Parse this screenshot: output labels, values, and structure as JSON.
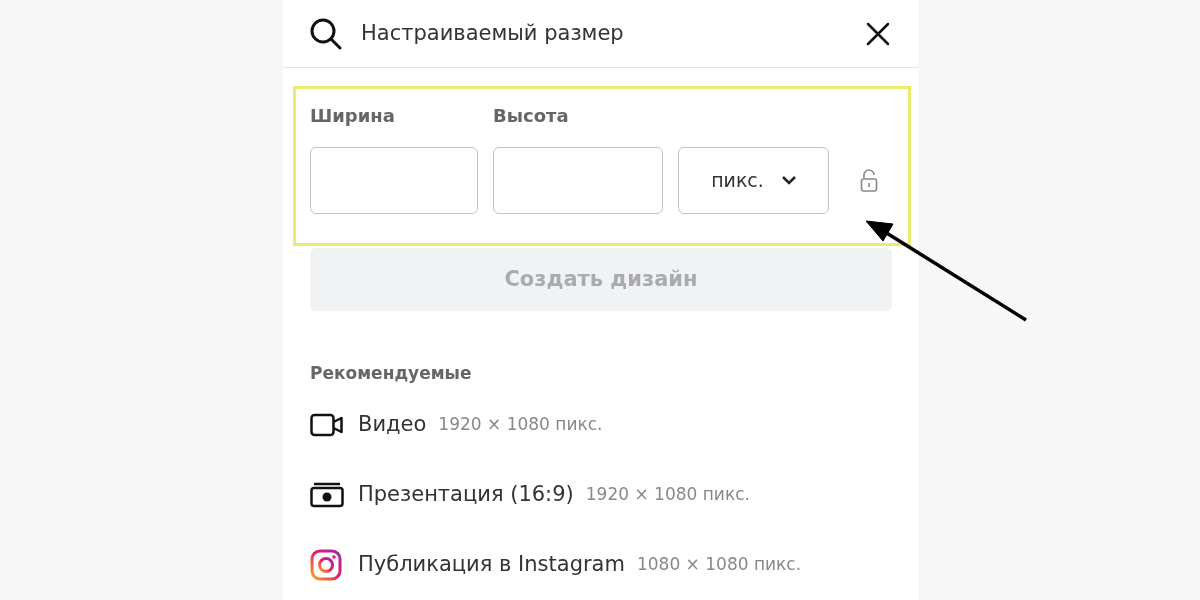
{
  "search": {
    "value": "Настраиваемый размер"
  },
  "custom_size": {
    "width_label": "Ширина",
    "height_label": "Высота",
    "unit": "пикс.",
    "locked": false,
    "highlighted": true
  },
  "create_button": {
    "label": "Создать дизайн",
    "disabled": true
  },
  "recommended": {
    "heading": "Рекомендуемые",
    "items": [
      {
        "kind": "video",
        "name": "Видео",
        "size": "1920 × 1080 пикс."
      },
      {
        "kind": "presentation",
        "name": "Презентация (16:9)",
        "size": "1920 × 1080 пикс."
      },
      {
        "kind": "instagram",
        "name": "Публикация в Instagram",
        "size": "1080 × 1080 пикс."
      }
    ]
  }
}
